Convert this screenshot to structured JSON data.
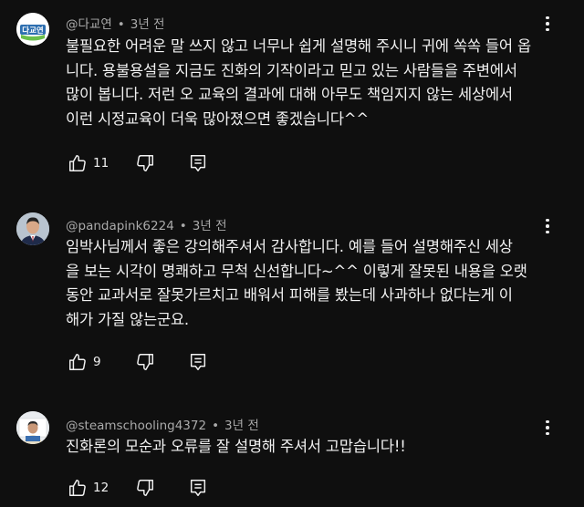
{
  "comments": [
    {
      "author": "@다교연",
      "time": "3년 전",
      "lines": [
        "불필요한 어려운 말 쓰지 않고 너무나 쉽게 설명해 주시니 귀에 쏙쏙 들어 옵",
        "니다. 용불용설을 지금도 진화의 기작이라고 믿고 있는 사람들을 주변에서",
        "많이 봅니다. 저런 오 교육의 결과에 대해 아무도 책임지지 않는 세상에서",
        "이런 시정교육이 더욱 많아졌으면 좋겠습니다^^"
      ],
      "likes": "11",
      "avatar_text": "다교연",
      "avatar_color": "#3b7bb5"
    },
    {
      "author": "@pandapink6224",
      "time": "3년 전",
      "lines": [
        "임박사님께서 좋은 강의해주셔서 감사합니다. 예를 들어 설명해주신  세상",
        "을 보는 시각이 명쾌하고 무척 신선합니다~^^ 이렇게 잘못된 내용을 오랫",
        "동안 교과서로 잘못가르치고 배워서  피해를  봤는데 사과하나 없다는게 이",
        "해가 가질 않는군요."
      ],
      "likes": "9"
    },
    {
      "author": "@steamschooling4372",
      "time": "3년 전",
      "lines": [
        "진화론의 모순과 오류를 잘 설명해 주셔서 고맙습니다!!"
      ],
      "likes": "12"
    }
  ],
  "meta_separator": "•",
  "colors": {
    "background": "#0f0f0f",
    "text": "#f1f1f1",
    "meta": "#aaaaaa"
  },
  "icons": {
    "like": "thumbs-up-icon",
    "dislike": "thumbs-down-icon",
    "reply": "reply-icon",
    "more": "more-vertical-icon"
  }
}
